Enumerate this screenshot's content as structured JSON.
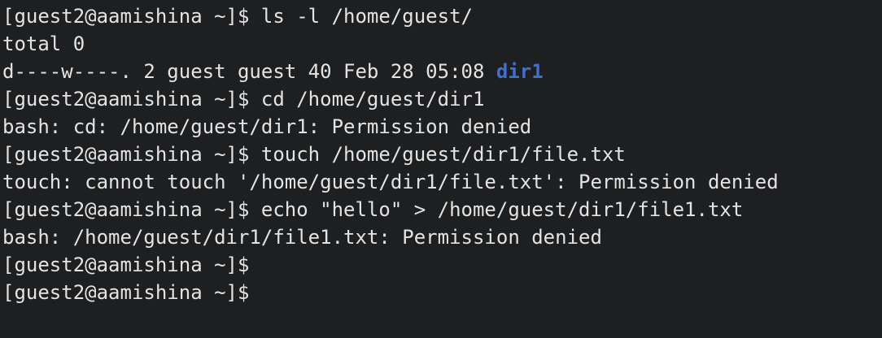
{
  "terminal": {
    "lines": [
      {
        "text": "[guest2@aamishina ~]$ ls -l /home/guest/"
      },
      {
        "text": "total 0"
      },
      {
        "text": "d----w----. 2 guest guest 40 Feb 28 05:08 ",
        "highlight": "dir1"
      },
      {
        "text": "[guest2@aamishina ~]$ cd /home/guest/dir1"
      },
      {
        "text": "bash: cd: /home/guest/dir1: Permission denied"
      },
      {
        "text": "[guest2@aamishina ~]$ touch /home/guest/dir1/file.txt"
      },
      {
        "text": "touch: cannot touch '/home/guest/dir1/file.txt': Permission denied"
      },
      {
        "text": "[guest2@aamishina ~]$ echo \"hello\" > /home/guest/dir1/file1.txt"
      },
      {
        "text": "bash: /home/guest/dir1/file1.txt: Permission denied"
      },
      {
        "text": "[guest2@aamishina ~]$"
      },
      {
        "text": "[guest2@aamishina ~]$"
      }
    ]
  },
  "colors": {
    "background": "#1e1f21",
    "foreground": "#e3e3e3",
    "directory": "#3f6fd1"
  }
}
